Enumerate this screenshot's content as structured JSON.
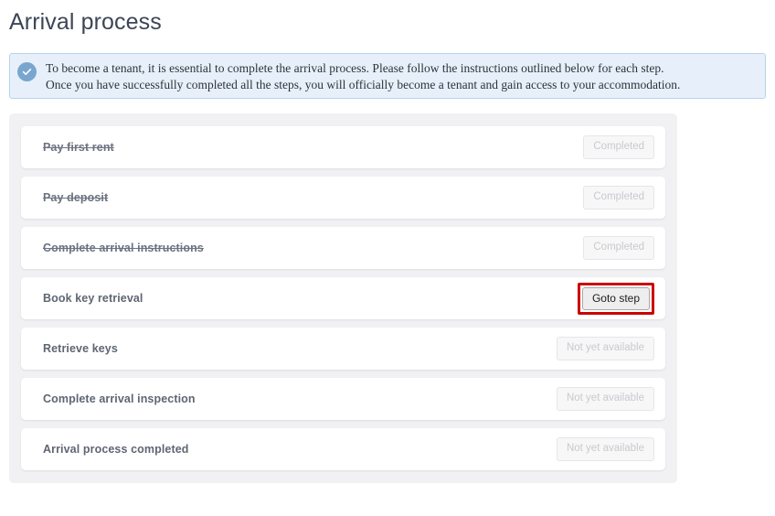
{
  "page": {
    "title": "Arrival process"
  },
  "banner": {
    "icon": "check-circle-icon",
    "text": "To become a tenant, it is essential to complete the arrival process. Please follow the instructions outlined below for each step.\nOnce you have successfully completed all the steps, you will officially become a tenant and gain access to your accommodation.",
    "background_color": "#e7f0fa",
    "border_color": "#b6d3ea",
    "icon_color": "#79a6cf"
  },
  "steps": [
    {
      "label": "Pay first rent",
      "action": "Completed",
      "state": "completed"
    },
    {
      "label": "Pay deposit",
      "action": "Completed",
      "state": "completed"
    },
    {
      "label": "Complete arrival instructions",
      "action": "Completed",
      "state": "completed"
    },
    {
      "label": "Book key retrieval",
      "action": "Goto step",
      "state": "current"
    },
    {
      "label": "Retrieve keys",
      "action": "Not yet available",
      "state": "locked"
    },
    {
      "label": "Complete arrival inspection",
      "action": "Not yet available",
      "state": "locked"
    },
    {
      "label": "Arrival process completed",
      "action": "Not yet available",
      "state": "locked"
    }
  ],
  "highlight": {
    "target": "Goto step",
    "color": "#cc0000"
  }
}
